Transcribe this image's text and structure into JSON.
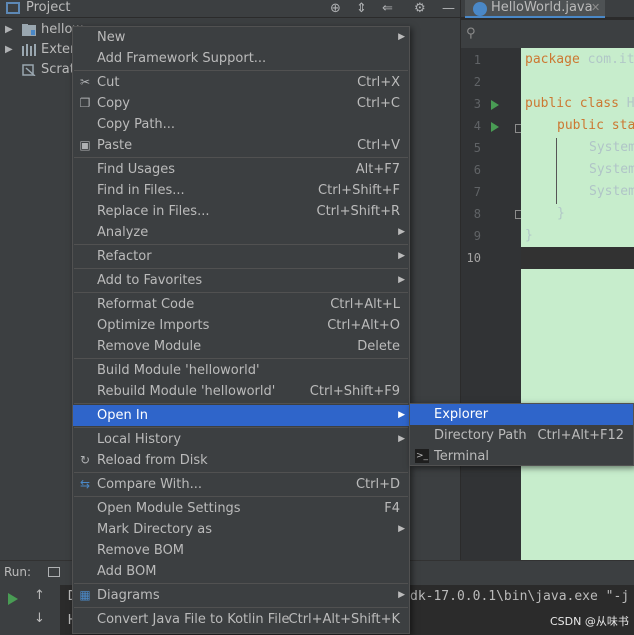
{
  "project_panel": {
    "title": "Project",
    "tree": [
      {
        "label": "hellow",
        "icon": "module-folder-icon",
        "expanded": false
      },
      {
        "label": "Exter",
        "icon": "external-libraries-icon",
        "expanded": false
      },
      {
        "label": "Scrat",
        "icon": "scratches-icon",
        "expanded": false
      }
    ]
  },
  "editor": {
    "tab_label": "HelloWorld.java",
    "line_numbers": [
      "1",
      "2",
      "3",
      "4",
      "5",
      "6",
      "7",
      "8",
      "9",
      "10"
    ],
    "code": {
      "line1_kw": "package",
      "line1_rest": " com.it",
      "line3_kw": "public class",
      "line3_rest": " H",
      "line4_kw": "public sta",
      "line5": "System",
      "line6": "System",
      "line7": "System",
      "line8": "}",
      "line9": "}"
    }
  },
  "run_panel": {
    "label": "Run:",
    "console_tail": "dk-17.0.0.1\\bin\\java.exe \"-j",
    "console_d": "D",
    "console_h": "H",
    "watermark": "CSDN @从味书"
  },
  "context_menu": {
    "items": [
      {
        "label": "New",
        "shortcut": "",
        "submenu": true
      },
      {
        "label": "Add Framework Support...",
        "shortcut": ""
      },
      {
        "label": "Cut",
        "shortcut": "Ctrl+X",
        "icon": "scissors-icon"
      },
      {
        "label": "Copy",
        "shortcut": "Ctrl+C",
        "icon": "copy-icon"
      },
      {
        "label": "Copy Path...",
        "shortcut": ""
      },
      {
        "label": "Paste",
        "shortcut": "Ctrl+V",
        "icon": "clipboard-icon"
      },
      {
        "label": "Find Usages",
        "shortcut": "Alt+F7"
      },
      {
        "label": "Find in Files...",
        "shortcut": "Ctrl+Shift+F"
      },
      {
        "label": "Replace in Files...",
        "shortcut": "Ctrl+Shift+R"
      },
      {
        "label": "Analyze",
        "shortcut": "",
        "submenu": true
      },
      {
        "label": "Refactor",
        "shortcut": "",
        "submenu": true
      },
      {
        "label": "Add to Favorites",
        "shortcut": "",
        "submenu": true
      },
      {
        "label": "Reformat Code",
        "shortcut": "Ctrl+Alt+L"
      },
      {
        "label": "Optimize Imports",
        "shortcut": "Ctrl+Alt+O"
      },
      {
        "label": "Remove Module",
        "shortcut": "Delete"
      },
      {
        "label": "Build Module 'helloworld'",
        "shortcut": ""
      },
      {
        "label": "Rebuild Module 'helloworld'",
        "shortcut": "Ctrl+Shift+F9"
      },
      {
        "label": "Open In",
        "shortcut": "",
        "submenu": true,
        "selected": true
      },
      {
        "label": "Local History",
        "shortcut": "",
        "submenu": true
      },
      {
        "label": "Reload from Disk",
        "shortcut": "",
        "icon": "reload-icon"
      },
      {
        "label": "Compare With...",
        "shortcut": "Ctrl+D",
        "icon": "compare-icon"
      },
      {
        "label": "Open Module Settings",
        "shortcut": "F4"
      },
      {
        "label": "Mark Directory as",
        "shortcut": "",
        "submenu": true
      },
      {
        "label": "Remove BOM",
        "shortcut": ""
      },
      {
        "label": "Add BOM",
        "shortcut": ""
      },
      {
        "label": "Diagrams",
        "shortcut": "",
        "submenu": true,
        "icon": "diagram-icon"
      },
      {
        "label": "Convert Java File to Kotlin File",
        "shortcut": "Ctrl+Alt+Shift+K"
      }
    ]
  },
  "submenu": {
    "items": [
      {
        "label": "Explorer",
        "shortcut": "",
        "selected": true
      },
      {
        "label": "Directory Path",
        "shortcut": "Ctrl+Alt+F12"
      },
      {
        "label": "Terminal",
        "shortcut": "",
        "icon": "terminal-icon"
      }
    ]
  },
  "colors": {
    "menu_bg": "#3c3f41",
    "selection": "#2f65ca",
    "code_bg": "#c7edcc",
    "keyword": "#cc7832"
  }
}
